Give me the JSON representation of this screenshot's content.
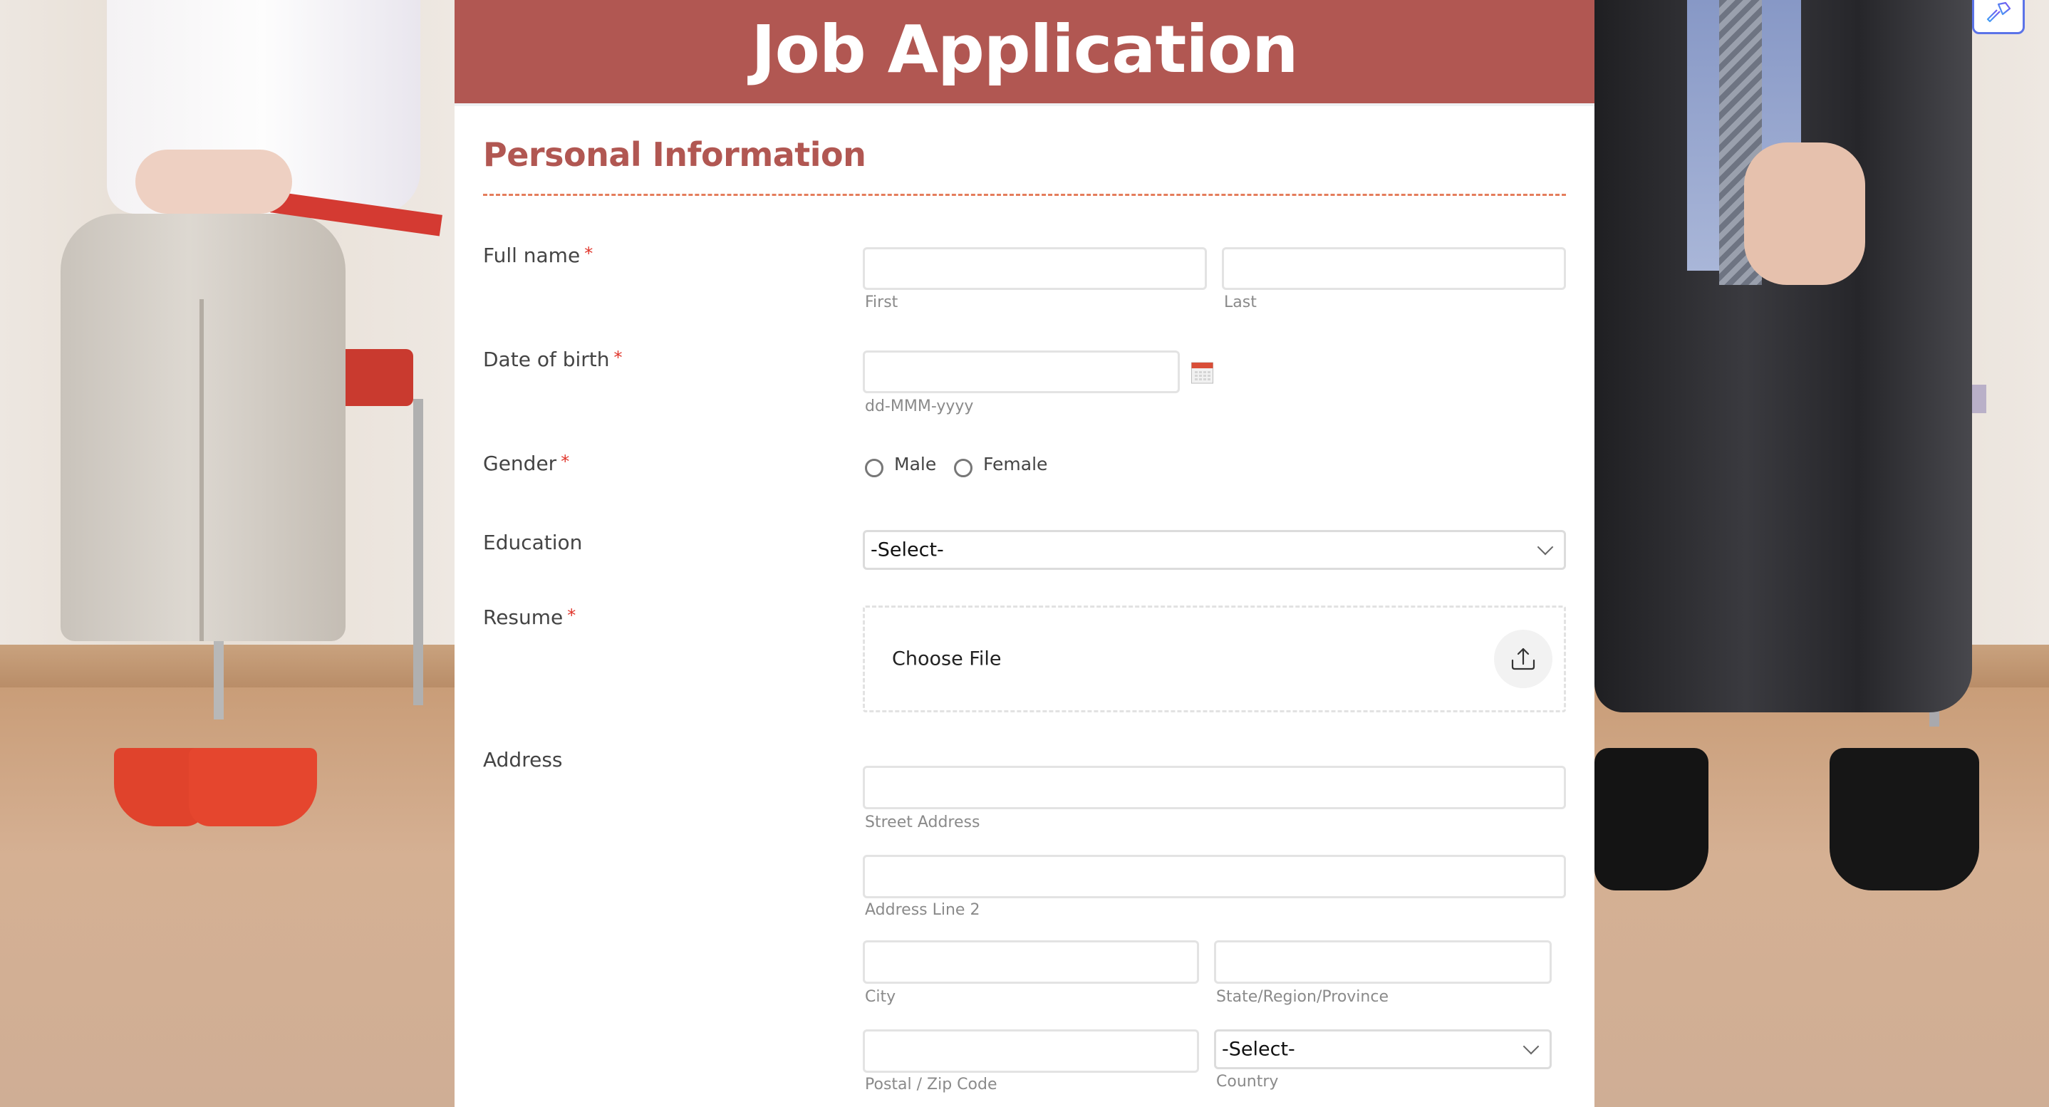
{
  "header": {
    "title": "Job Application"
  },
  "section": {
    "title": "Personal Information"
  },
  "colors": {
    "brand": "#b15752",
    "divider": "#e47d5c",
    "required": "#e0352b",
    "theme_button_border": "#5b73e8"
  },
  "fields": {
    "full_name": {
      "label": "Full name",
      "required": "*",
      "first_sub": "First",
      "last_sub": "Last",
      "first_value": "",
      "last_value": ""
    },
    "dob": {
      "label": "Date of birth",
      "required": "*",
      "sub": "dd-MMM-yyyy",
      "value": "",
      "icon": "calendar-icon"
    },
    "gender": {
      "label": "Gender",
      "required": "*",
      "options": [
        "Male",
        "Female"
      ],
      "selected": null
    },
    "education": {
      "label": "Education",
      "selected": "-Select-"
    },
    "resume": {
      "label": "Resume",
      "required": "*",
      "button": "Choose File",
      "icon": "upload-icon"
    },
    "address": {
      "label": "Address",
      "street_sub": "Street Address",
      "line2_sub": "Address Line 2",
      "city_sub": "City",
      "state_sub": "State/Region/Province",
      "postal_sub": "Postal / Zip Code",
      "country_sub": "Country",
      "country_selected": "-Select-"
    }
  },
  "toolbar": {
    "theme_icon": "paint-brush-icon"
  }
}
